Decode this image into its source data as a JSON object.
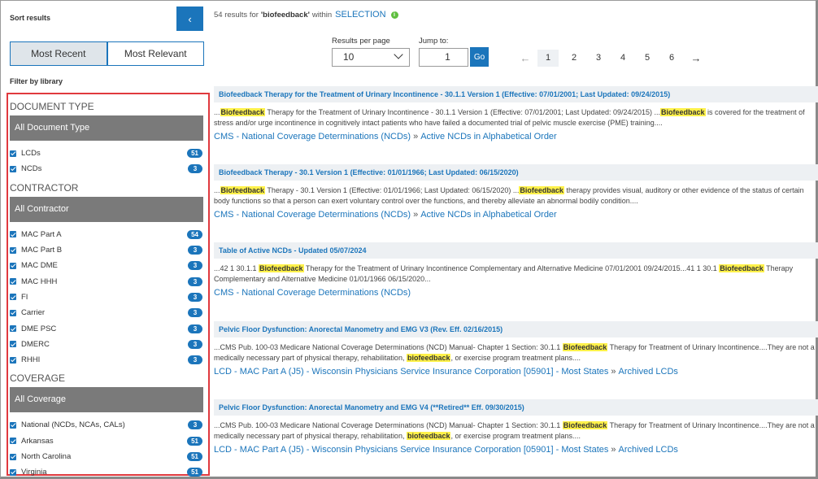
{
  "sidebar": {
    "sort_title": "Sort results",
    "collapse_glyph": "‹",
    "sort_tabs": [
      "Most Recent",
      "Most Relevant"
    ],
    "filter_title": "Filter by library",
    "groups": [
      {
        "heading": "Document Type",
        "bar": "All Document Type",
        "items": [
          {
            "label": "LCDs",
            "count": "51"
          },
          {
            "label": "NCDs",
            "count": "3"
          }
        ]
      },
      {
        "heading": "Contractor",
        "bar": "All Contractor",
        "items": [
          {
            "label": "MAC Part A",
            "count": "54"
          },
          {
            "label": "MAC Part B",
            "count": "3"
          },
          {
            "label": "MAC DME",
            "count": "3"
          },
          {
            "label": "MAC HHH",
            "count": "3"
          },
          {
            "label": "FI",
            "count": "3"
          },
          {
            "label": "Carrier",
            "count": "3"
          },
          {
            "label": "DME PSC",
            "count": "3"
          },
          {
            "label": "DMERC",
            "count": "3"
          },
          {
            "label": "RHHI",
            "count": "3"
          }
        ]
      },
      {
        "heading": "Coverage",
        "bar": "All Coverage",
        "items": [
          {
            "label": "National (NCDs, NCAs, CALs)",
            "count": "3"
          },
          {
            "label": "Arkansas",
            "count": "51"
          },
          {
            "label": "North Carolina",
            "count": "51"
          },
          {
            "label": "Virginia",
            "count": "51"
          }
        ]
      }
    ]
  },
  "summary": {
    "count_text": "54 results for",
    "query": "'biofeedback'",
    "within": "within",
    "selection": "SELECTION",
    "info_glyph": "i"
  },
  "controls": {
    "rpp_label": "Results per page",
    "rpp_value": "10",
    "jump_label": "Jump to:",
    "jump_value": "1",
    "go_label": "Go"
  },
  "pager": {
    "prev": "←",
    "next": "→",
    "pages": [
      "1",
      "2",
      "3",
      "4",
      "5",
      "6"
    ],
    "current": "1"
  },
  "results": [
    {
      "title": "Biofeedback Therapy for the Treatment of Urinary Incontinence - 30.1.1 Version 1 (Effective: 07/01/2001; Last Updated: 09/24/2015)",
      "snippet": [
        {
          "t": "..."
        },
        {
          "h": "Biofeedback"
        },
        {
          "t": " Therapy for the Treatment of Urinary Incontinence - 30.1.1 Version 1 (Effective: 07/01/2001; Last Updated: 09/24/2015) ..."
        },
        {
          "h": "Biofeedback"
        },
        {
          "t": " is covered for the treatment of stress and/or urge incontinence in cognitively intact patients who have failed a documented trial of pelvic muscle exercise (PME) training...."
        }
      ],
      "links": [
        "CMS - National Coverage Determinations (NCDs)",
        "Active NCDs in Alphabetical Order"
      ]
    },
    {
      "title": "Biofeedback Therapy - 30.1 Version 1 (Effective: 01/01/1966; Last Updated: 06/15/2020)",
      "snippet": [
        {
          "t": "..."
        },
        {
          "h": "Biofeedback"
        },
        {
          "t": " Therapy - 30.1 Version 1 (Effective: 01/01/1966; Last Updated: 06/15/2020) ..."
        },
        {
          "h": "Biofeedback"
        },
        {
          "t": " therapy provides visual, auditory or other evidence of the status of certain body functions so that a person can exert voluntary control over the functions, and thereby alleviate an abnormal bodily condition...."
        }
      ],
      "links": [
        "CMS - National Coverage Determinations (NCDs)",
        "Active NCDs in Alphabetical Order"
      ]
    },
    {
      "title": "Table of Active NCDs - Updated 05/07/2024",
      "snippet": [
        {
          "t": "...42 1 30.1.1 "
        },
        {
          "h": "Biofeedback"
        },
        {
          "t": " Therapy for the Treatment of Urinary Incontinence Complementary and Alternative Medicine 07/01/2001 09/24/2015...41 1 30.1 "
        },
        {
          "h": "Biofeedback"
        },
        {
          "t": " Therapy Complementary and Alternative Medicine 01/01/1966 06/15/2020..."
        }
      ],
      "links": [
        "CMS - National Coverage Determinations (NCDs)"
      ]
    },
    {
      "title": "Pelvic Floor Dysfunction: Anorectal Manometry and EMG V3 (Rev. Eff. 02/16/2015)",
      "snippet": [
        {
          "t": "...CMS Pub. 100-03 Medicare National Coverage Determinations (NCD) Manual- Chapter 1 Section: 30.1.1 "
        },
        {
          "h": "Biofeedback"
        },
        {
          "t": " Therapy for Treatment of Urinary Incontinence....They are not a medically necessary part of physical therapy, rehabilitation, "
        },
        {
          "h": "biofeedback"
        },
        {
          "t": ", or exercise program treatment plans...."
        }
      ],
      "links": [
        "LCD - MAC Part A (J5) - Wisconsin Physicians Service Insurance Corporation [05901] - Most States",
        "Archived LCDs"
      ]
    },
    {
      "title": "Pelvic Floor Dysfunction: Anorectal Manometry and EMG V4 (**Retired** Eff. 09/30/2015)",
      "snippet": [
        {
          "t": "...CMS Pub. 100-03 Medicare National Coverage Determinations (NCD) Manual- Chapter 1 Section: 30.1.1 "
        },
        {
          "h": "Biofeedback"
        },
        {
          "t": " Therapy for Treatment of Urinary Incontinence....They are not a medically necessary part of physical therapy, rehabilitation, "
        },
        {
          "h": "biofeedback"
        },
        {
          "t": ", or exercise program treatment plans...."
        }
      ],
      "links": [
        "LCD - MAC Part A (J5) - Wisconsin Physicians Service Insurance Corporation [05901] - Most States",
        "Archived LCDs"
      ]
    }
  ]
}
